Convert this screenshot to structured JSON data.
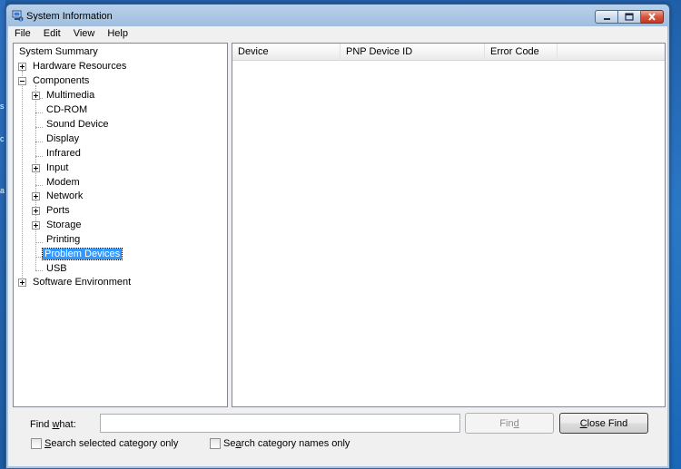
{
  "window": {
    "title": "System Information",
    "app_icon": "system-information-icon"
  },
  "caption_buttons": {
    "minimize_icon": "minimize-icon",
    "maximize_icon": "maximize-icon",
    "close_icon": "close-icon"
  },
  "menu": [
    "File",
    "Edit",
    "View",
    "Help"
  ],
  "tree": {
    "items": [
      {
        "label": "System Summary"
      },
      {
        "label": "Hardware Resources"
      },
      {
        "label": "Components"
      },
      {
        "label": "Multimedia"
      },
      {
        "label": "CD-ROM"
      },
      {
        "label": "Sound Device"
      },
      {
        "label": "Display"
      },
      {
        "label": "Infrared"
      },
      {
        "label": "Input"
      },
      {
        "label": "Modem"
      },
      {
        "label": "Network"
      },
      {
        "label": "Ports"
      },
      {
        "label": "Storage"
      },
      {
        "label": "Printing"
      },
      {
        "label": "Problem Devices"
      },
      {
        "label": "USB"
      },
      {
        "label": "Software Environment"
      }
    ],
    "selected": "Problem Devices"
  },
  "list": {
    "columns": [
      "Device",
      "PNP Device ID",
      "Error Code"
    ],
    "rows": []
  },
  "find": {
    "label_pre": "Find ",
    "label_ul": "w",
    "label_post": "hat:",
    "value": "",
    "find_button_pre": "Fin",
    "find_button_ul": "d",
    "find_button_post": "",
    "close_button_pre": "",
    "close_button_ul": "C",
    "close_button_post": "lose Find",
    "search_selected_pre": "",
    "search_selected_ul": "S",
    "search_selected_post": "earch selected category only",
    "search_selected_checked": false,
    "search_names_pre": "Se",
    "search_names_ul": "a",
    "search_names_post": "rch category names only",
    "search_names_checked": false
  },
  "colors": {
    "selection": "#3399ff",
    "titlebar": "#b9d1ea",
    "desktop": "#2b78c8",
    "close_button": "#c43a22"
  }
}
